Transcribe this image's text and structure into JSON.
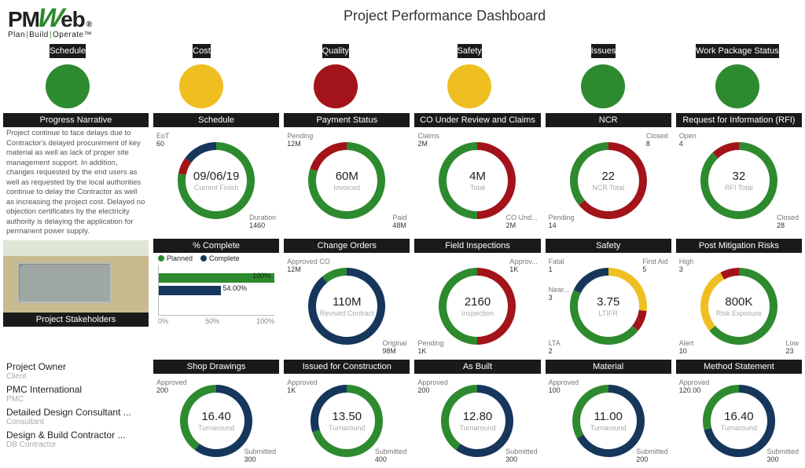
{
  "header": {
    "brand_pre": "PM",
    "brand_w": "W",
    "brand_post": "eb",
    "reg": "®",
    "tagline_plan": "Plan",
    "tagline_build": "Build",
    "tagline_operate": "Operate",
    "tm": "™",
    "title": "Project Performance Dashboard"
  },
  "top_status": [
    {
      "label": "Schedule",
      "color": "#2e8a2e"
    },
    {
      "label": "Cost",
      "color": "#efbf22"
    },
    {
      "label": "Quality",
      "color": "#a3131a"
    },
    {
      "label": "Safety",
      "color": "#efbf22"
    },
    {
      "label": "Issues",
      "color": "#2e8a2e"
    },
    {
      "label": "Work Package Status",
      "color": "#2e8a2e"
    }
  ],
  "left": {
    "narr_title": "Progress Narrative",
    "narr_text": "Project continue to face delays due to Contractor's delayed procurement of key material as well as lack of proper site management support. In addition, changes requested by the end users as well as requested by the local authorities continue to delay the Contractor as well as increasing the project cost. Delayed no objection certificates by the electricity authority is delaying the application for permanent power supply.",
    "stake_title": "Project Stakeholders",
    "stakes": [
      {
        "org": "Project Owner",
        "role": "Client"
      },
      {
        "org": "PMC International",
        "role": "PMC"
      },
      {
        "org": "Detailed Design Consultant ...",
        "role": "Consultant"
      },
      {
        "org": "Design & Build Contractor ...",
        "role": "DB Contractor"
      }
    ]
  },
  "row1": [
    {
      "title": "Schedule",
      "center_v": "09/06/19",
      "center_c": "Current Finish",
      "labels": {
        "tl": {
          "t": "EoT",
          "n": "60"
        },
        "br": {
          "t": "Duration",
          "n": "1460"
        }
      },
      "segs": [
        {
          "c": "#2e8a2e",
          "f": 0.78
        },
        {
          "c": "#a3131a",
          "f": 0.07
        },
        {
          "c": "#16365c",
          "f": 0.15
        }
      ]
    },
    {
      "title": "Payment Status",
      "center_v": "60M",
      "center_c": "Invoiced",
      "labels": {
        "tl": {
          "t": "Pending",
          "n": "12M"
        },
        "br": {
          "t": "Paid",
          "n": "48M"
        }
      },
      "segs": [
        {
          "c": "#2e8a2e",
          "f": 0.8
        },
        {
          "c": "#a3131a",
          "f": 0.2
        }
      ]
    },
    {
      "title": "CO Under Review and Claims",
      "center_v": "4M",
      "center_c": "Total",
      "labels": {
        "tl": {
          "t": "Claims",
          "n": "2M"
        },
        "br": {
          "t": "CO Und...",
          "n": "2M"
        }
      },
      "segs": [
        {
          "c": "#a3131a",
          "f": 0.5
        },
        {
          "c": "#2e8a2e",
          "f": 0.5
        }
      ]
    },
    {
      "title": "NCR",
      "center_v": "22",
      "center_c": "NCR Total",
      "labels": {
        "tr": {
          "t": "Closed",
          "n": "8"
        },
        "bl": {
          "t": "Pending",
          "n": "14"
        }
      },
      "segs": [
        {
          "c": "#a3131a",
          "f": 0.64
        },
        {
          "c": "#2e8a2e",
          "f": 0.36
        }
      ]
    },
    {
      "title": "Request for Information (RFI)",
      "center_v": "32",
      "center_c": "RFI Total",
      "labels": {
        "tl": {
          "t": "Open",
          "n": "4"
        },
        "br": {
          "t": "Closed",
          "n": "28"
        }
      },
      "segs": [
        {
          "c": "#2e8a2e",
          "f": 0.88
        },
        {
          "c": "#a3131a",
          "f": 0.12
        }
      ]
    }
  ],
  "pct": {
    "title": "% Complete",
    "planned_label": "Planned",
    "complete_label": "Complete",
    "planned": 100,
    "complete": 54.0,
    "planned_txt": "100%",
    "complete_txt": "54.00%",
    "axis": [
      "0%",
      "50%",
      "100%"
    ]
  },
  "row2": [
    {
      "title": "Change Orders",
      "center_v": "110M",
      "center_c": "Revised Contract",
      "labels": {
        "tl": {
          "t": "Approved CO",
          "n": "12M"
        },
        "br": {
          "t": "Original",
          "n": "98M"
        }
      },
      "segs": [
        {
          "c": "#16365c",
          "f": 0.89
        },
        {
          "c": "#2e8a2e",
          "f": 0.11
        }
      ]
    },
    {
      "title": "Field Inspections",
      "center_v": "2160",
      "center_c": "Inspection",
      "labels": {
        "tr": {
          "t": "Approv...",
          "n": "1K"
        },
        "bl": {
          "t": "Pending",
          "n": "1K"
        }
      },
      "segs": [
        {
          "c": "#a3131a",
          "f": 0.5
        },
        {
          "c": "#2e8a2e",
          "f": 0.5
        }
      ]
    },
    {
      "title": "Safety",
      "center_v": "3.75",
      "center_c": "LTIFR",
      "labels": {
        "tl": {
          "t": "Fatal",
          "n": "1"
        },
        "tr": {
          "t": "First Aid",
          "n": "5"
        },
        "bl": {
          "t": "LTA",
          "n": "2"
        },
        "bl2": {
          "t": "Near...",
          "n": "3"
        }
      },
      "segs": [
        {
          "c": "#efbf22",
          "f": 0.27
        },
        {
          "c": "#a3131a",
          "f": 0.09
        },
        {
          "c": "#2e8a2e",
          "f": 0.46
        },
        {
          "c": "#16365c",
          "f": 0.18
        }
      ]
    },
    {
      "title": "Post Mitigation Risks",
      "center_v": "800K",
      "center_c": "Risk Exposure",
      "labels": {
        "tl": {
          "t": "High",
          "n": "3"
        },
        "br": {
          "t": "Low",
          "n": "23"
        },
        "bl": {
          "t": "Alert",
          "n": "10"
        }
      },
      "segs": [
        {
          "c": "#2e8a2e",
          "f": 0.64
        },
        {
          "c": "#efbf22",
          "f": 0.28
        },
        {
          "c": "#a3131a",
          "f": 0.08
        }
      ]
    }
  ],
  "row3": [
    {
      "title": "Shop Drawings",
      "center_v": "16.40",
      "center_c": "Turnaround",
      "labels": {
        "tl": {
          "t": "Approved",
          "n": "200"
        },
        "br": {
          "t": "Submitted",
          "n": "300"
        }
      },
      "segs": [
        {
          "c": "#16365c",
          "f": 0.6
        },
        {
          "c": "#2e8a2e",
          "f": 0.4
        }
      ]
    },
    {
      "title": "Issued for Construction",
      "center_v": "13.50",
      "center_c": "Turnaround",
      "labels": {
        "tl": {
          "t": "Approved",
          "n": "1K"
        },
        "br": {
          "t": "Submitted",
          "n": "400"
        }
      },
      "segs": [
        {
          "c": "#2e8a2e",
          "f": 0.7
        },
        {
          "c": "#16365c",
          "f": 0.3
        }
      ]
    },
    {
      "title": "As Built",
      "center_v": "12.80",
      "center_c": "Turnaround",
      "labels": {
        "tl": {
          "t": "Approved",
          "n": "200"
        },
        "br": {
          "t": "Submitted",
          "n": "300"
        }
      },
      "segs": [
        {
          "c": "#16365c",
          "f": 0.6
        },
        {
          "c": "#2e8a2e",
          "f": 0.4
        }
      ]
    },
    {
      "title": "Material",
      "center_v": "11.00",
      "center_c": "Turnaround",
      "labels": {
        "tl": {
          "t": "Approved",
          "n": "100"
        },
        "br": {
          "t": "Submitted",
          "n": "200"
        }
      },
      "segs": [
        {
          "c": "#16365c",
          "f": 0.67
        },
        {
          "c": "#2e8a2e",
          "f": 0.33
        }
      ]
    },
    {
      "title": "Method Statement",
      "center_v": "16.40",
      "center_c": "Turnaround",
      "labels": {
        "tl": {
          "t": "Approved",
          "n": "120.00"
        },
        "br": {
          "t": "Submitted",
          "n": "300"
        }
      },
      "segs": [
        {
          "c": "#16365c",
          "f": 0.71
        },
        {
          "c": "#2e8a2e",
          "f": 0.29
        }
      ]
    }
  ],
  "chart_data": {
    "top_status": [
      {
        "metric": "Schedule",
        "status": "green"
      },
      {
        "metric": "Cost",
        "status": "yellow"
      },
      {
        "metric": "Quality",
        "status": "red"
      },
      {
        "metric": "Safety",
        "status": "yellow"
      },
      {
        "metric": "Issues",
        "status": "green"
      },
      {
        "metric": "Work Package Status",
        "status": "green"
      }
    ],
    "percent_complete": {
      "type": "bar",
      "categories": [
        "Planned",
        "Complete"
      ],
      "values": [
        100,
        54.0
      ],
      "xlabel": "",
      "ylabel": "",
      "xlim": [
        0,
        100
      ],
      "title": "% Complete"
    },
    "donuts": [
      {
        "title": "Schedule",
        "center": "09/06/19",
        "center_label": "Current Finish",
        "series": [
          {
            "name": "EoT",
            "value": 60
          },
          {
            "name": "Duration",
            "value": 1460
          }
        ]
      },
      {
        "title": "Payment Status",
        "center": "60M",
        "center_label": "Invoiced",
        "series": [
          {
            "name": "Pending",
            "value": 12
          },
          {
            "name": "Paid",
            "value": 48
          }
        ],
        "unit": "M"
      },
      {
        "title": "CO Under Review and Claims",
        "center": "4M",
        "center_label": "Total",
        "series": [
          {
            "name": "Claims",
            "value": 2
          },
          {
            "name": "CO Under Review",
            "value": 2
          }
        ],
        "unit": "M"
      },
      {
        "title": "NCR",
        "center": 22,
        "center_label": "NCR Total",
        "series": [
          {
            "name": "Closed",
            "value": 8
          },
          {
            "name": "Pending",
            "value": 14
          }
        ]
      },
      {
        "title": "Request for Information (RFI)",
        "center": 32,
        "center_label": "RFI Total",
        "series": [
          {
            "name": "Open",
            "value": 4
          },
          {
            "name": "Closed",
            "value": 28
          }
        ]
      },
      {
        "title": "Change Orders",
        "center": "110M",
        "center_label": "Revised Contract",
        "series": [
          {
            "name": "Approved CO",
            "value": 12
          },
          {
            "name": "Original",
            "value": 98
          }
        ],
        "unit": "M"
      },
      {
        "title": "Field Inspections",
        "center": 2160,
        "center_label": "Inspection",
        "series": [
          {
            "name": "Approved",
            "value": 1000
          },
          {
            "name": "Pending",
            "value": 1000
          }
        ]
      },
      {
        "title": "Safety",
        "center": 3.75,
        "center_label": "LTIFR",
        "series": [
          {
            "name": "Fatal",
            "value": 1
          },
          {
            "name": "First Aid",
            "value": 5
          },
          {
            "name": "Near Miss",
            "value": 3
          },
          {
            "name": "LTA",
            "value": 2
          }
        ]
      },
      {
        "title": "Post Mitigation Risks",
        "center": "800K",
        "center_label": "Risk Exposure",
        "series": [
          {
            "name": "High",
            "value": 3
          },
          {
            "name": "Alert",
            "value": 10
          },
          {
            "name": "Low",
            "value": 23
          }
        ]
      },
      {
        "title": "Shop Drawings",
        "center": 16.4,
        "center_label": "Turnaround",
        "series": [
          {
            "name": "Approved",
            "value": 200
          },
          {
            "name": "Submitted",
            "value": 300
          }
        ]
      },
      {
        "title": "Issued for Construction",
        "center": 13.5,
        "center_label": "Turnaround",
        "series": [
          {
            "name": "Approved",
            "value": 1000
          },
          {
            "name": "Submitted",
            "value": 400
          }
        ]
      },
      {
        "title": "As Built",
        "center": 12.8,
        "center_label": "Turnaround",
        "series": [
          {
            "name": "Approved",
            "value": 200
          },
          {
            "name": "Submitted",
            "value": 300
          }
        ]
      },
      {
        "title": "Material",
        "center": 11.0,
        "center_label": "Turnaround",
        "series": [
          {
            "name": "Approved",
            "value": 100
          },
          {
            "name": "Submitted",
            "value": 200
          }
        ]
      },
      {
        "title": "Method Statement",
        "center": 16.4,
        "center_label": "Turnaround",
        "series": [
          {
            "name": "Approved",
            "value": 120
          },
          {
            "name": "Submitted",
            "value": 300
          }
        ]
      }
    ]
  }
}
